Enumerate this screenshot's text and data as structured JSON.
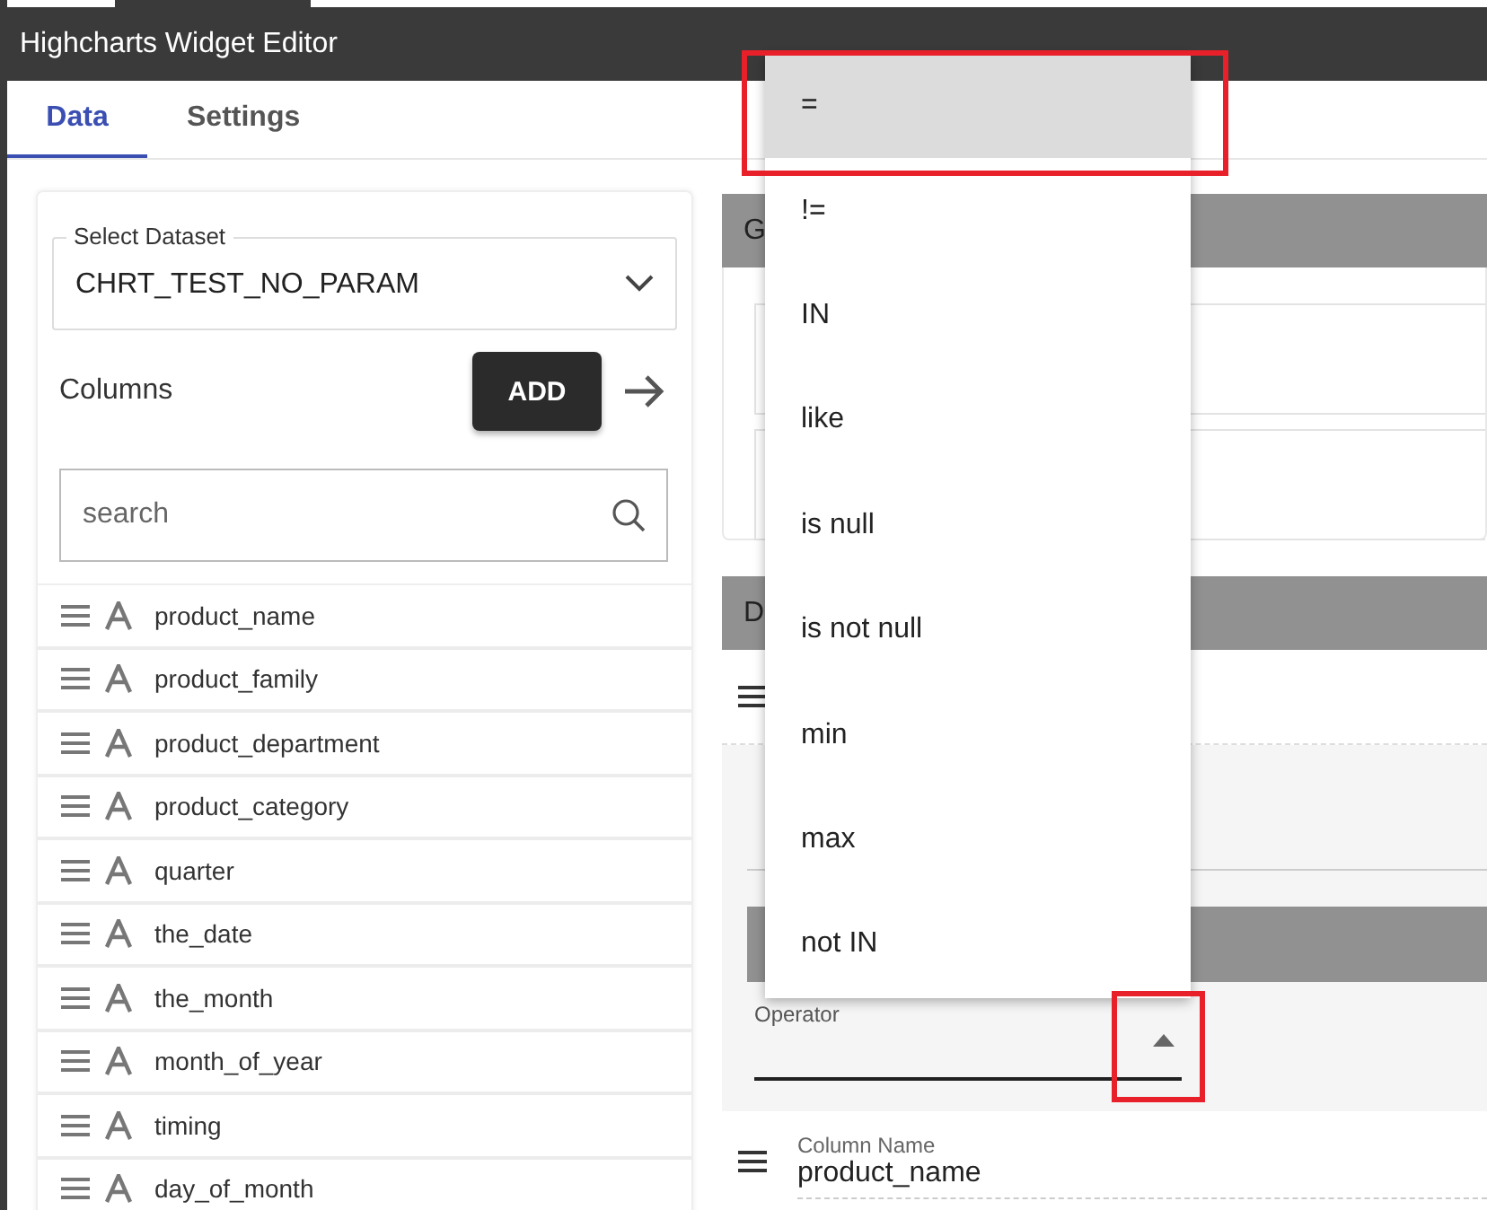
{
  "window": {
    "title": "Highcharts Widget Editor"
  },
  "tabs": [
    {
      "label": "Data",
      "selected": true
    },
    {
      "label": "Settings",
      "selected": false
    }
  ],
  "dataset": {
    "label": "Select Dataset",
    "value": "CHRT_TEST_NO_PARAM"
  },
  "columns": {
    "title": "Columns",
    "add_button": "ADD",
    "search": {
      "placeholder": "search"
    },
    "items": [
      "product_name",
      "product_family",
      "product_department",
      "product_category",
      "quarter",
      "the_date",
      "the_month",
      "month_of_year",
      "timing",
      "day_of_month"
    ]
  },
  "right_panel": {
    "sections": [
      {
        "header": "G"
      },
      {
        "header": "D"
      }
    ],
    "operator": {
      "label": "Operator",
      "expanded": true
    },
    "column_row": {
      "label": "Column Name",
      "value": "product_name"
    }
  },
  "operator_menu": {
    "options": [
      {
        "label": "=",
        "selected": true
      },
      {
        "label": "!=",
        "selected": false
      },
      {
        "label": "IN",
        "selected": false
      },
      {
        "label": "like",
        "selected": false
      },
      {
        "label": "is null",
        "selected": false
      },
      {
        "label": "is not null",
        "selected": false
      },
      {
        "label": "min",
        "selected": false
      },
      {
        "label": "max",
        "selected": false
      },
      {
        "label": "not IN",
        "selected": false
      }
    ]
  }
}
